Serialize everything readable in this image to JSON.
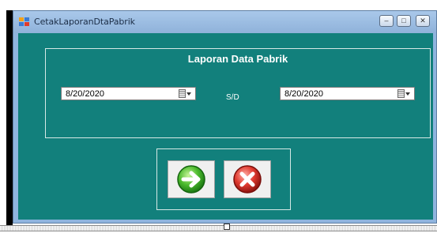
{
  "window": {
    "title": "CetakLaporanDtaPabrik",
    "controls": {
      "minimize": "–",
      "maximize": "□",
      "close": "✕"
    }
  },
  "form": {
    "heading": "Laporan Data Pabrik",
    "date_from": "8/20/2020",
    "separator_label": "S/D",
    "date_to": "8/20/2020"
  },
  "actions": {
    "print_icon": "arrow-right-icon",
    "cancel_icon": "close-x-icon"
  },
  "colors": {
    "client_background": "#12807c",
    "title_bar": "#9dbde3",
    "go_button": "#2aa52a",
    "cancel_button": "#d12b2b"
  }
}
